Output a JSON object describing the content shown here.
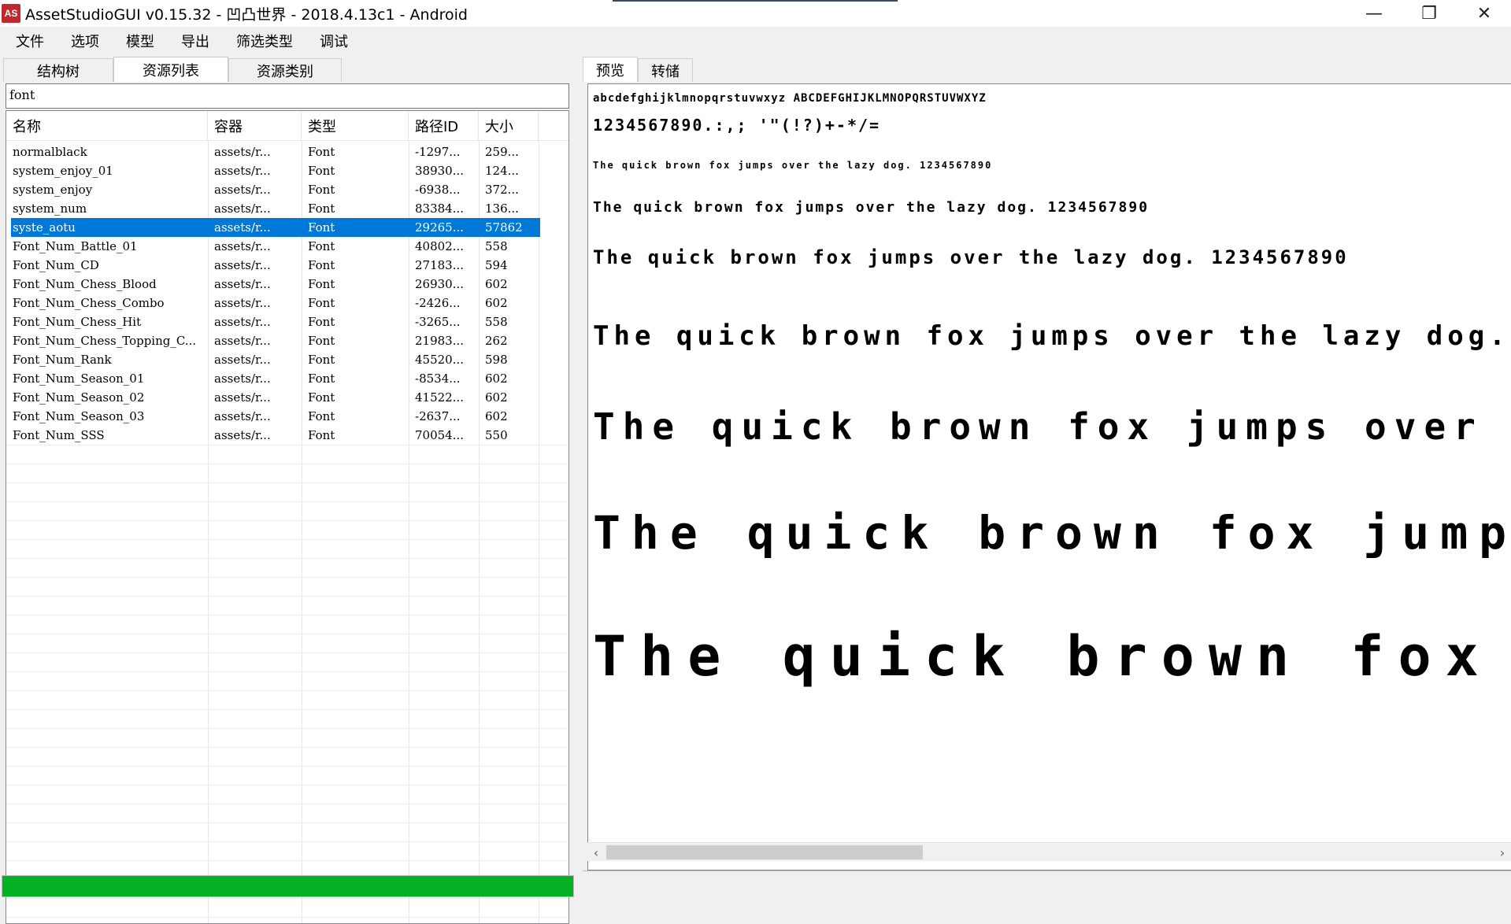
{
  "window": {
    "app_icon_text": "AS",
    "title": "AssetStudioGUI v0.15.32 - 凹凸世界 - 2018.4.13c1 - Android",
    "minimize": "—",
    "maximize": "❐",
    "close": "✕"
  },
  "menu": [
    "文件",
    "选项",
    "模型",
    "导出",
    "筛选类型",
    "调试"
  ],
  "left_tabs": [
    "结构树",
    "资源列表",
    "资源类别"
  ],
  "search": {
    "value": "font"
  },
  "columns": [
    "名称",
    "容器",
    "类型",
    "路径ID",
    "大小"
  ],
  "rows": [
    {
      "name": "normalblack",
      "container": "assets/r...",
      "type": "Font",
      "path_id": "-1297...",
      "size": "259..."
    },
    {
      "name": "system_enjoy_01",
      "container": "assets/r...",
      "type": "Font",
      "path_id": "38930...",
      "size": "124..."
    },
    {
      "name": "system_enjoy",
      "container": "assets/r...",
      "type": "Font",
      "path_id": "-6938...",
      "size": "372..."
    },
    {
      "name": "system_num",
      "container": "assets/r...",
      "type": "Font",
      "path_id": "83384...",
      "size": "136..."
    },
    {
      "name": "syste_aotu",
      "container": "assets/r...",
      "type": "Font",
      "path_id": "29265...",
      "size": "57862"
    },
    {
      "name": "Font_Num_Battle_01",
      "container": "assets/r...",
      "type": "Font",
      "path_id": "40802...",
      "size": "558"
    },
    {
      "name": "Font_Num_CD",
      "container": "assets/r...",
      "type": "Font",
      "path_id": "27183...",
      "size": "594"
    },
    {
      "name": "Font_Num_Chess_Blood",
      "container": "assets/r...",
      "type": "Font",
      "path_id": "26930...",
      "size": "602"
    },
    {
      "name": "Font_Num_Chess_Combo",
      "container": "assets/r...",
      "type": "Font",
      "path_id": "-2426...",
      "size": "602"
    },
    {
      "name": "Font_Num_Chess_Hit",
      "container": "assets/r...",
      "type": "Font",
      "path_id": "-3265...",
      "size": "558"
    },
    {
      "name": "Font_Num_Chess_Topping_C...",
      "container": "assets/r...",
      "type": "Font",
      "path_id": "21983...",
      "size": "262"
    },
    {
      "name": "Font_Num_Rank",
      "container": "assets/r...",
      "type": "Font",
      "path_id": "45520...",
      "size": "598"
    },
    {
      "name": "Font_Num_Season_01",
      "container": "assets/r...",
      "type": "Font",
      "path_id": "-8534...",
      "size": "602"
    },
    {
      "name": "Font_Num_Season_02",
      "container": "assets/r...",
      "type": "Font",
      "path_id": "41522...",
      "size": "602"
    },
    {
      "name": "Font_Num_Season_03",
      "container": "assets/r...",
      "type": "Font",
      "path_id": "-2637...",
      "size": "602"
    },
    {
      "name": "Font_Num_SSS",
      "container": "assets/r...",
      "type": "Font",
      "path_id": "70054...",
      "size": "550"
    }
  ],
  "selected_row": 4,
  "progress": {
    "value": 1.0,
    "color": "#06b025"
  },
  "right_tabs": [
    "预览",
    "转储"
  ],
  "preview": {
    "alphabet_line": "abcdefghijklmnopqrstuvwxyz ABCDEFGHIJKLMNOPQRSTUVWXYZ",
    "symbols_line": "1234567890.:,; '\"(!?)+-*/=",
    "pangram": "The quick brown fox jumps over the lazy dog. 1234567890",
    "pangram_short": "The quick brown fox jumps over the lazy dog."
  },
  "colors": {
    "selection": "#0078d7",
    "progress": "#06b025"
  }
}
